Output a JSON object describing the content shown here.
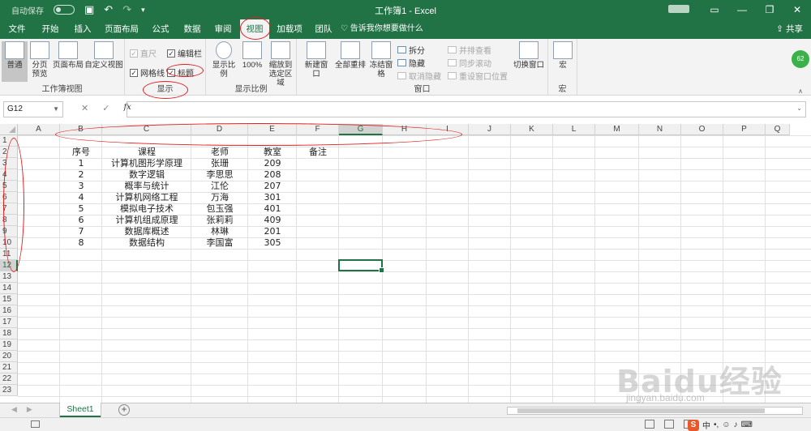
{
  "app": {
    "window_title": "工作簿1  -  Excel",
    "autosave_label": "自动保存",
    "autosave_state": "关",
    "share_label": "共享",
    "avatar_text": "62"
  },
  "tabs": [
    {
      "label": "文件",
      "active": false
    },
    {
      "label": "开始",
      "active": false
    },
    {
      "label": "插入",
      "active": false
    },
    {
      "label": "页面布局",
      "active": false
    },
    {
      "label": "公式",
      "active": false
    },
    {
      "label": "数据",
      "active": false
    },
    {
      "label": "审阅",
      "active": false
    },
    {
      "label": "视图",
      "active": true
    },
    {
      "label": "加载项",
      "active": false
    },
    {
      "label": "团队",
      "active": false
    }
  ],
  "tell_me": "告诉我你想要做什么",
  "ribbon": {
    "workbook_views": {
      "label": "工作簿视图",
      "buttons": [
        "普通",
        "分页预览",
        "页面布局",
        "自定义视图"
      ]
    },
    "show": {
      "label": "显示",
      "checks": [
        {
          "label": "直尺",
          "checked": true,
          "disabled": true
        },
        {
          "label": "编辑栏",
          "checked": true,
          "disabled": false
        },
        {
          "label": "网格线",
          "checked": true,
          "disabled": false
        },
        {
          "label": "标题",
          "checked": true,
          "disabled": false
        }
      ]
    },
    "zoom": {
      "label": "显示比例",
      "buttons": [
        "显示比例",
        "100%",
        "缩放到选定区域"
      ]
    },
    "window": {
      "label": "窗口",
      "big": [
        "新建窗口",
        "全部重排",
        "冻结窗格"
      ],
      "small": [
        {
          "label": "拆分",
          "disabled": false
        },
        {
          "label": "隐藏",
          "disabled": false
        },
        {
          "label": "取消隐藏",
          "disabled": true
        },
        {
          "label": "并排查看",
          "disabled": true
        },
        {
          "label": "同步滚动",
          "disabled": true
        },
        {
          "label": "重设窗口位置",
          "disabled": true
        }
      ],
      "switch": "切换窗口"
    },
    "macros": {
      "label": "宏",
      "button": "宏"
    }
  },
  "formula_bar": {
    "name_box": "G12",
    "fx": "fx",
    "value": ""
  },
  "columns": [
    "A",
    "B",
    "C",
    "D",
    "E",
    "F",
    "G",
    "H",
    "I",
    "J",
    "K",
    "L",
    "M",
    "N",
    "O",
    "P",
    "Q"
  ],
  "selected_column": "G",
  "rows": [
    "1",
    "2",
    "3",
    "4",
    "5",
    "6",
    "7",
    "8",
    "9",
    "10",
    "11",
    "12",
    "13",
    "14",
    "15",
    "16",
    "17",
    "18",
    "19",
    "20",
    "21",
    "22",
    "23"
  ],
  "selected_row": "12",
  "table": {
    "headers": [
      "序号",
      "课程",
      "老师",
      "教室",
      "备注"
    ],
    "rows": [
      [
        "1",
        "计算机图形学原理",
        "张珊",
        "209"
      ],
      [
        "2",
        "数字逻辑",
        "李思思",
        "208"
      ],
      [
        "3",
        "概率与统计",
        "江伦",
        "207"
      ],
      [
        "4",
        "计算机网络工程",
        "万海",
        "301"
      ],
      [
        "5",
        "模拟电子技术",
        "包玉强",
        "401"
      ],
      [
        "6",
        "计算机组成原理",
        "张莉莉",
        "409"
      ],
      [
        "7",
        "数据库概述",
        "林琳",
        "201"
      ],
      [
        "8",
        "数据结构",
        "李国富",
        "305"
      ]
    ]
  },
  "sheet_tab": "Sheet1",
  "status_ime": "中",
  "watermark": "Baidu经验",
  "watermark_sub": "jingyan.baidu.com"
}
